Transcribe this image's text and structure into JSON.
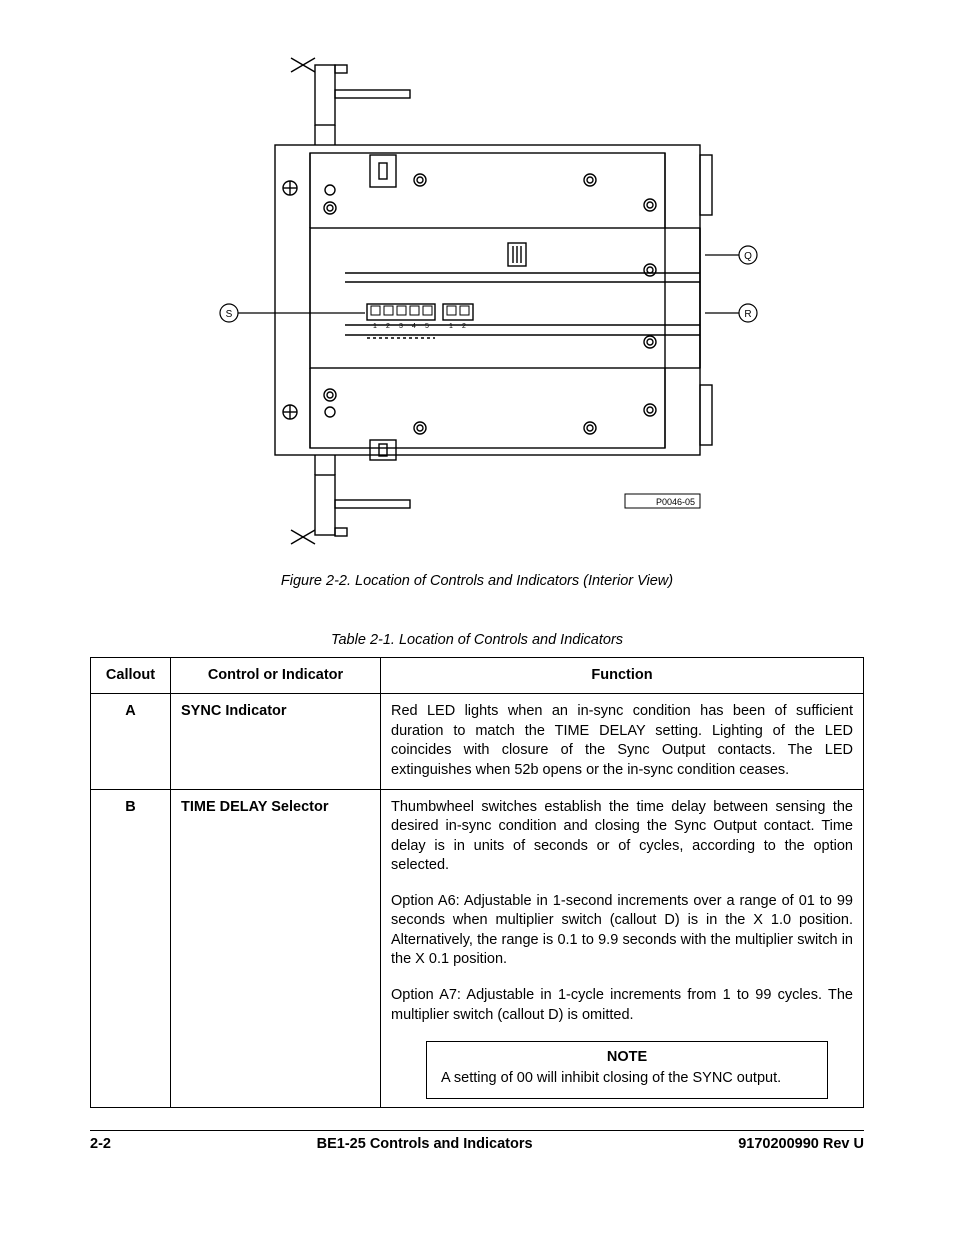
{
  "figure": {
    "caption": "Figure 2-2. Location of Controls and Indicators (Interior View)",
    "drawing_id": "P0046-05",
    "callouts": {
      "left": "S",
      "right_top": "Q",
      "right_bottom": "R"
    },
    "dip_labels_a": [
      "1",
      "2",
      "3",
      "4",
      "5"
    ],
    "dip_labels_b": [
      "1",
      "2"
    ]
  },
  "table": {
    "caption": "Table 2-1. Location of Controls and Indicators",
    "headers": {
      "callout": "Callout",
      "control": "Control or Indicator",
      "function": "Function"
    },
    "rows": [
      {
        "callout": "A",
        "control": "SYNC Indicator",
        "function_paras": [
          "Red LED lights when an in-sync condition has been of sufficient duration to match the TIME DELAY setting. Lighting of the LED coincides with closure of the Sync Output contacts. The LED extinguishes when 52b opens or the in-sync condition ceases."
        ],
        "note": null
      },
      {
        "callout": "B",
        "control": "TIME DELAY Selector",
        "function_paras": [
          "Thumbwheel switches establish the time delay between sensing the desired in-sync condition and closing the Sync Output contact. Time delay is in units of seconds or of cycles, according to the option selected.",
          "Option A6:  Adjustable in 1-second increments over a range of 01 to 99 seconds when multiplier switch (callout D) is in the X 1.0 position. Alternatively, the range is 0.1 to 9.9 seconds with the multiplier switch in the X 0.1 position.",
          "Option A7:  Adjustable in 1-cycle increments from 1 to 99 cycles. The multiplier switch (callout D) is omitted."
        ],
        "note": {
          "title": "NOTE",
          "text": "A setting of 00 will inhibit closing of the SYNC output."
        }
      }
    ]
  },
  "footer": {
    "left": "2-2",
    "center": "BE1-25 Controls and Indicators",
    "right": "9170200990 Rev U"
  }
}
